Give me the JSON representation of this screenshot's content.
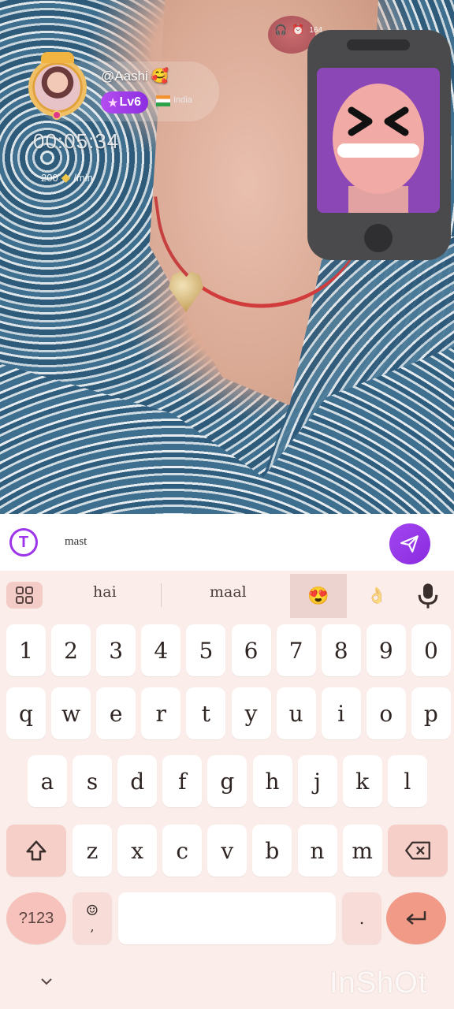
{
  "stream": {
    "username": "@Aashi",
    "username_emoji": "🥰",
    "level": "Lv6",
    "country": "India",
    "timer": "00:05:34",
    "coins": "200",
    "coins_unit": "/min"
  },
  "status_icons": [
    "headset-icon",
    "alarm-icon",
    "speed-indicator",
    "signal-icon",
    "battery-icon"
  ],
  "status_speed": "164",
  "chat_input": {
    "value": "mast"
  },
  "suggestions": {
    "word1": "hai",
    "word2": "maal",
    "emoji1": "😍",
    "emoji2": "👌"
  },
  "keyboard": {
    "number_row": [
      "1",
      "2",
      "3",
      "4",
      "5",
      "6",
      "7",
      "8",
      "9",
      "0"
    ],
    "row1": [
      "q",
      "w",
      "e",
      "r",
      "t",
      "y",
      "u",
      "i",
      "o",
      "p"
    ],
    "row2": [
      "a",
      "s",
      "d",
      "f",
      "g",
      "h",
      "j",
      "k",
      "l"
    ],
    "row3": [
      "z",
      "x",
      "c",
      "v",
      "b",
      "n",
      "m"
    ],
    "symbols_label": "?123",
    "emoji_key": "☺",
    "comma_key": ",",
    "period_key": "."
  },
  "watermark": "InShOt",
  "colors": {
    "accent_purple": "#9b34ea",
    "keyboard_bg": "#fbeeea",
    "key_special": "#f6cfc9",
    "enter_key": "#f29a88"
  }
}
